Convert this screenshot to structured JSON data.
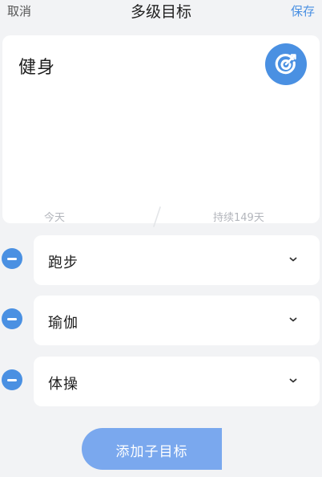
{
  "header": {
    "cancel_label": "取消",
    "title": "多级目标",
    "save_label": "保存"
  },
  "goal": {
    "title": "健身",
    "icon": "target-icon",
    "start_label": "今天",
    "duration_label": "持续149天"
  },
  "sub_goals": [
    {
      "label": "跑步"
    },
    {
      "label": "瑜伽"
    },
    {
      "label": "体操"
    }
  ],
  "add_button_label": "添加子目标",
  "colors": {
    "accent": "#4a90e2",
    "button": "#7aa8ee",
    "background": "#f2f3f5",
    "card": "#ffffff",
    "muted_text": "#b3b6bc"
  }
}
